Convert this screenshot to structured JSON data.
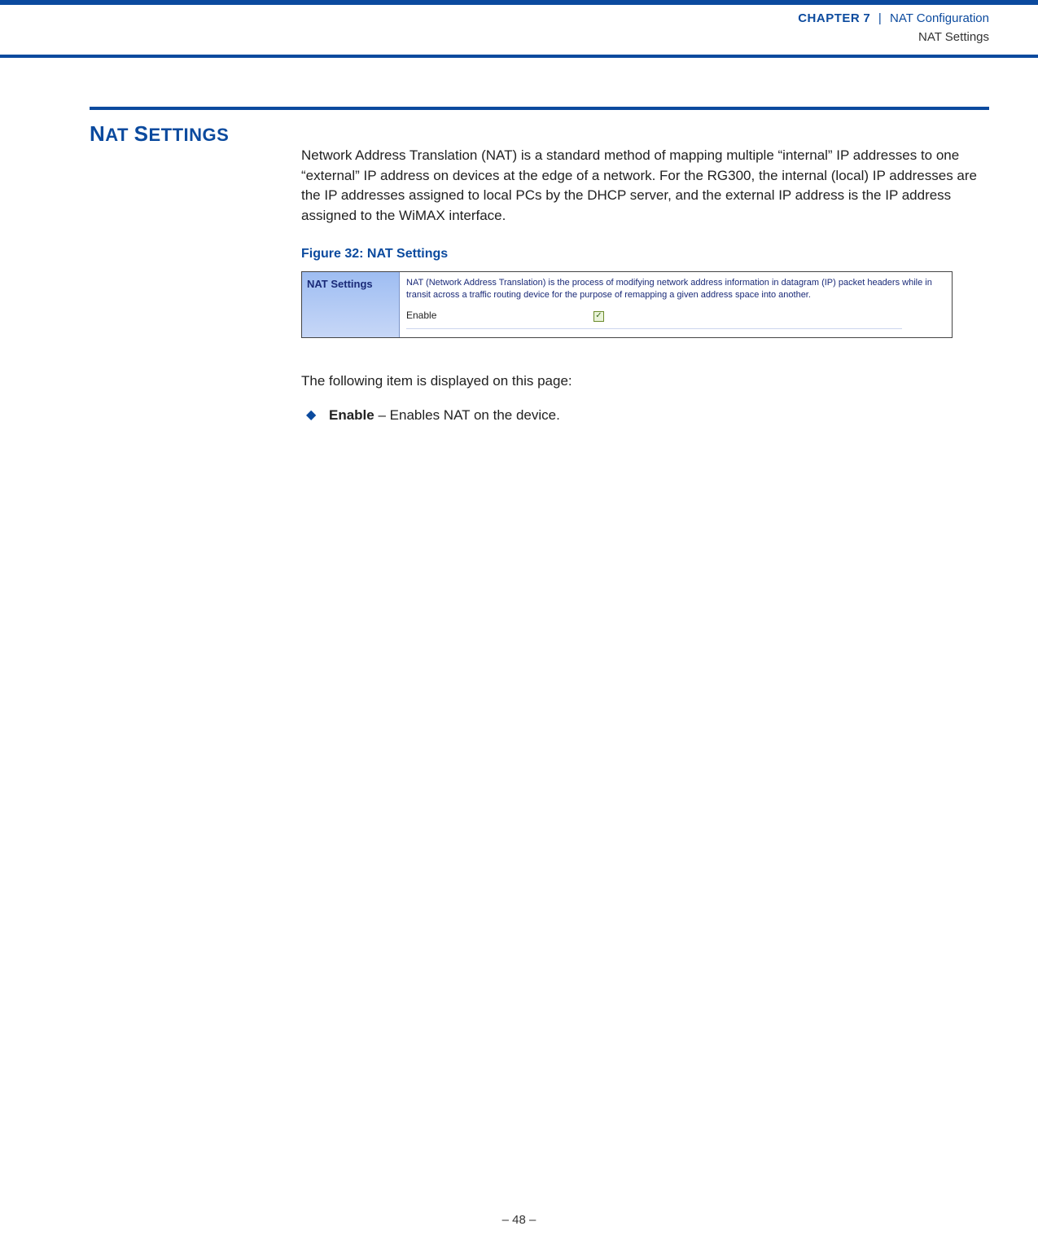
{
  "header": {
    "chapter_label_prefix": "C",
    "chapter_label_rest": "HAPTER",
    "chapter_number": "7",
    "separator": "|",
    "chapter_title": "NAT Configuration",
    "subtitle": "NAT Settings"
  },
  "section": {
    "heading_part1_first": "N",
    "heading_part1_rest": "AT",
    "heading_part2_first": "S",
    "heading_part2_rest": "ETTINGS",
    "intro": "Network Address Translation (NAT) is a standard method of mapping multiple “internal” IP addresses to one “external” IP address on devices at the edge of a network. For the RG300, the internal (local) IP addresses are the IP addresses assigned to local PCs by the DHCP server, and the external IP address is the IP address assigned to the WiMAX interface."
  },
  "figure": {
    "caption": "Figure 32:  NAT Settings",
    "side_label": "NAT Settings",
    "description": "NAT (Network Address Translation) is the process of modifying network address information in datagram (IP) packet headers while in transit across a traffic routing device for the purpose of remapping a given address space into another.",
    "row_label": "Enable",
    "checkbox_checked": true
  },
  "post_figure_text": "The following item is displayed on this page:",
  "bullet": {
    "term": "Enable",
    "description": " – Enables NAT on the device."
  },
  "footer": {
    "page_label": "–  48  –"
  }
}
